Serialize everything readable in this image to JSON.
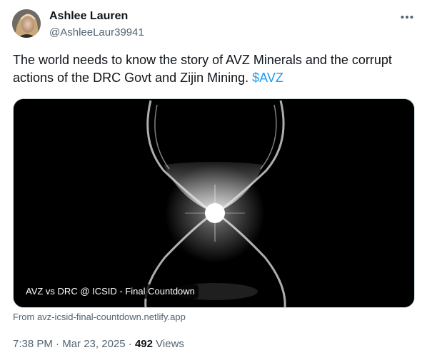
{
  "author": {
    "name": "Ashlee Lauren",
    "handle": "@AshleeLaur39941"
  },
  "tweet": {
    "text": "The world needs to know the story of AVZ Minerals and the corrupt actions of the DRC Govt and Zijin Mining.",
    "cashtag": "$AVZ"
  },
  "card": {
    "title": "AVZ vs DRC @ ICSID - Final Countdown",
    "from_label": "From avz-icsid-final-countdown.netlify.app"
  },
  "meta": {
    "time": "7:38 PM",
    "separator": "·",
    "date": "Mar 23, 2025",
    "views_count": "492",
    "views_label": "Views"
  },
  "icons": {
    "more": "more-dots-icon"
  },
  "colors": {
    "link": "#1d9bf0",
    "secondary_text": "#536471",
    "primary_text": "#0f1419",
    "border": "#cfd9de"
  }
}
